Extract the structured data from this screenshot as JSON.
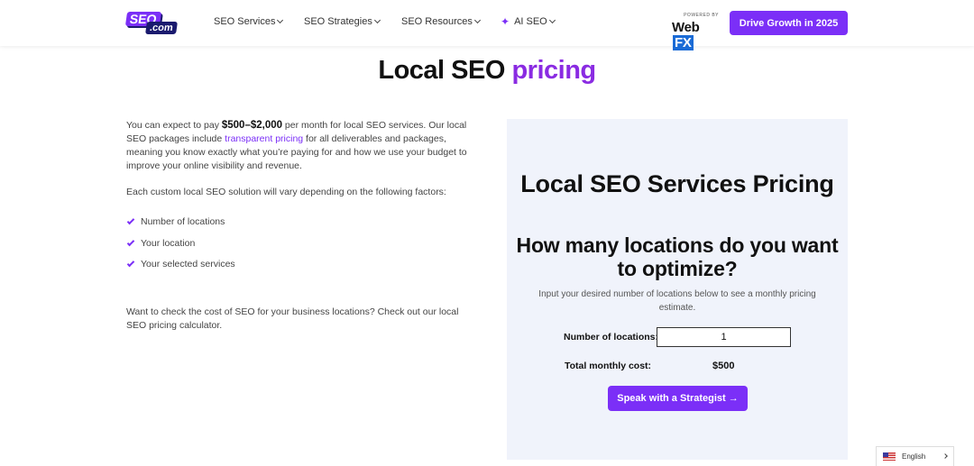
{
  "logo": {
    "top": "SEO",
    "bottom": ".com"
  },
  "nav": [
    {
      "label": "SEO Services"
    },
    {
      "label": "SEO Strategies"
    },
    {
      "label": "SEO Resources"
    },
    {
      "label": "AI SEO"
    }
  ],
  "webfx": {
    "powered": "POWERED BY",
    "web": "Web",
    "fx": "FX"
  },
  "header_cta": "Drive Growth in 2025",
  "title": {
    "main": "Local SEO ",
    "accent": "pricing"
  },
  "left": {
    "p1_before": "You can expect to pay ",
    "p1_bold": "$500–$2,000",
    "p1_after": " per month for local SEO services. Our local SEO packages include ",
    "p1_link": "transparent pricing",
    "p1_end": " for all deliverables and packages, meaning you know exactly what you’re paying for and how we use your budget to improve your online visibility and revenue.",
    "p2": "Each custom local SEO solution will vary depending on the following factors:",
    "factors": [
      "Number of locations",
      "Your location",
      "Your selected services"
    ],
    "p3": "Want to check the cost of SEO for your business locations? Check out our local SEO pricing calculator."
  },
  "calculator": {
    "heading": "Local SEO Services Pricing",
    "question": "How many locations do you want to optimize?",
    "description": "Input your desired number of locations below to see a monthly pricing estimate.",
    "locations_label": "Number of locations:",
    "locations_value": "1",
    "cost_label": "Total monthly cost:",
    "cost_value": "$500",
    "cta": "Speak with a Strategist →"
  },
  "language": {
    "label": "English"
  },
  "colors": {
    "accent": "#7b2ff7",
    "panel": "#f0f3fb",
    "title_accent": "#8a2be2"
  }
}
